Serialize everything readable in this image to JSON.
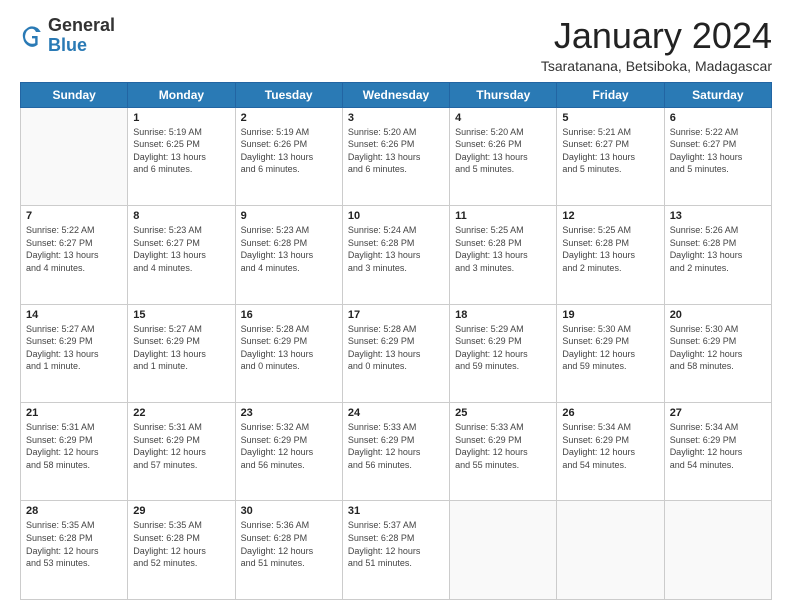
{
  "logo": {
    "general": "General",
    "blue": "Blue"
  },
  "header": {
    "month": "January 2024",
    "location": "Tsaratanana, Betsiboka, Madagascar"
  },
  "weekdays": [
    "Sunday",
    "Monday",
    "Tuesday",
    "Wednesday",
    "Thursday",
    "Friday",
    "Saturday"
  ],
  "weeks": [
    [
      {
        "day": "",
        "info": ""
      },
      {
        "day": "1",
        "info": "Sunrise: 5:19 AM\nSunset: 6:25 PM\nDaylight: 13 hours\nand 6 minutes."
      },
      {
        "day": "2",
        "info": "Sunrise: 5:19 AM\nSunset: 6:26 PM\nDaylight: 13 hours\nand 6 minutes."
      },
      {
        "day": "3",
        "info": "Sunrise: 5:20 AM\nSunset: 6:26 PM\nDaylight: 13 hours\nand 6 minutes."
      },
      {
        "day": "4",
        "info": "Sunrise: 5:20 AM\nSunset: 6:26 PM\nDaylight: 13 hours\nand 5 minutes."
      },
      {
        "day": "5",
        "info": "Sunrise: 5:21 AM\nSunset: 6:27 PM\nDaylight: 13 hours\nand 5 minutes."
      },
      {
        "day": "6",
        "info": "Sunrise: 5:22 AM\nSunset: 6:27 PM\nDaylight: 13 hours\nand 5 minutes."
      }
    ],
    [
      {
        "day": "7",
        "info": "Sunrise: 5:22 AM\nSunset: 6:27 PM\nDaylight: 13 hours\nand 4 minutes."
      },
      {
        "day": "8",
        "info": "Sunrise: 5:23 AM\nSunset: 6:27 PM\nDaylight: 13 hours\nand 4 minutes."
      },
      {
        "day": "9",
        "info": "Sunrise: 5:23 AM\nSunset: 6:28 PM\nDaylight: 13 hours\nand 4 minutes."
      },
      {
        "day": "10",
        "info": "Sunrise: 5:24 AM\nSunset: 6:28 PM\nDaylight: 13 hours\nand 3 minutes."
      },
      {
        "day": "11",
        "info": "Sunrise: 5:25 AM\nSunset: 6:28 PM\nDaylight: 13 hours\nand 3 minutes."
      },
      {
        "day": "12",
        "info": "Sunrise: 5:25 AM\nSunset: 6:28 PM\nDaylight: 13 hours\nand 2 minutes."
      },
      {
        "day": "13",
        "info": "Sunrise: 5:26 AM\nSunset: 6:28 PM\nDaylight: 13 hours\nand 2 minutes."
      }
    ],
    [
      {
        "day": "14",
        "info": "Sunrise: 5:27 AM\nSunset: 6:29 PM\nDaylight: 13 hours\nand 1 minute."
      },
      {
        "day": "15",
        "info": "Sunrise: 5:27 AM\nSunset: 6:29 PM\nDaylight: 13 hours\nand 1 minute."
      },
      {
        "day": "16",
        "info": "Sunrise: 5:28 AM\nSunset: 6:29 PM\nDaylight: 13 hours\nand 0 minutes."
      },
      {
        "day": "17",
        "info": "Sunrise: 5:28 AM\nSunset: 6:29 PM\nDaylight: 13 hours\nand 0 minutes."
      },
      {
        "day": "18",
        "info": "Sunrise: 5:29 AM\nSunset: 6:29 PM\nDaylight: 12 hours\nand 59 minutes."
      },
      {
        "day": "19",
        "info": "Sunrise: 5:30 AM\nSunset: 6:29 PM\nDaylight: 12 hours\nand 59 minutes."
      },
      {
        "day": "20",
        "info": "Sunrise: 5:30 AM\nSunset: 6:29 PM\nDaylight: 12 hours\nand 58 minutes."
      }
    ],
    [
      {
        "day": "21",
        "info": "Sunrise: 5:31 AM\nSunset: 6:29 PM\nDaylight: 12 hours\nand 58 minutes."
      },
      {
        "day": "22",
        "info": "Sunrise: 5:31 AM\nSunset: 6:29 PM\nDaylight: 12 hours\nand 57 minutes."
      },
      {
        "day": "23",
        "info": "Sunrise: 5:32 AM\nSunset: 6:29 PM\nDaylight: 12 hours\nand 56 minutes."
      },
      {
        "day": "24",
        "info": "Sunrise: 5:33 AM\nSunset: 6:29 PM\nDaylight: 12 hours\nand 56 minutes."
      },
      {
        "day": "25",
        "info": "Sunrise: 5:33 AM\nSunset: 6:29 PM\nDaylight: 12 hours\nand 55 minutes."
      },
      {
        "day": "26",
        "info": "Sunrise: 5:34 AM\nSunset: 6:29 PM\nDaylight: 12 hours\nand 54 minutes."
      },
      {
        "day": "27",
        "info": "Sunrise: 5:34 AM\nSunset: 6:29 PM\nDaylight: 12 hours\nand 54 minutes."
      }
    ],
    [
      {
        "day": "28",
        "info": "Sunrise: 5:35 AM\nSunset: 6:28 PM\nDaylight: 12 hours\nand 53 minutes."
      },
      {
        "day": "29",
        "info": "Sunrise: 5:35 AM\nSunset: 6:28 PM\nDaylight: 12 hours\nand 52 minutes."
      },
      {
        "day": "30",
        "info": "Sunrise: 5:36 AM\nSunset: 6:28 PM\nDaylight: 12 hours\nand 51 minutes."
      },
      {
        "day": "31",
        "info": "Sunrise: 5:37 AM\nSunset: 6:28 PM\nDaylight: 12 hours\nand 51 minutes."
      },
      {
        "day": "",
        "info": ""
      },
      {
        "day": "",
        "info": ""
      },
      {
        "day": "",
        "info": ""
      }
    ]
  ]
}
